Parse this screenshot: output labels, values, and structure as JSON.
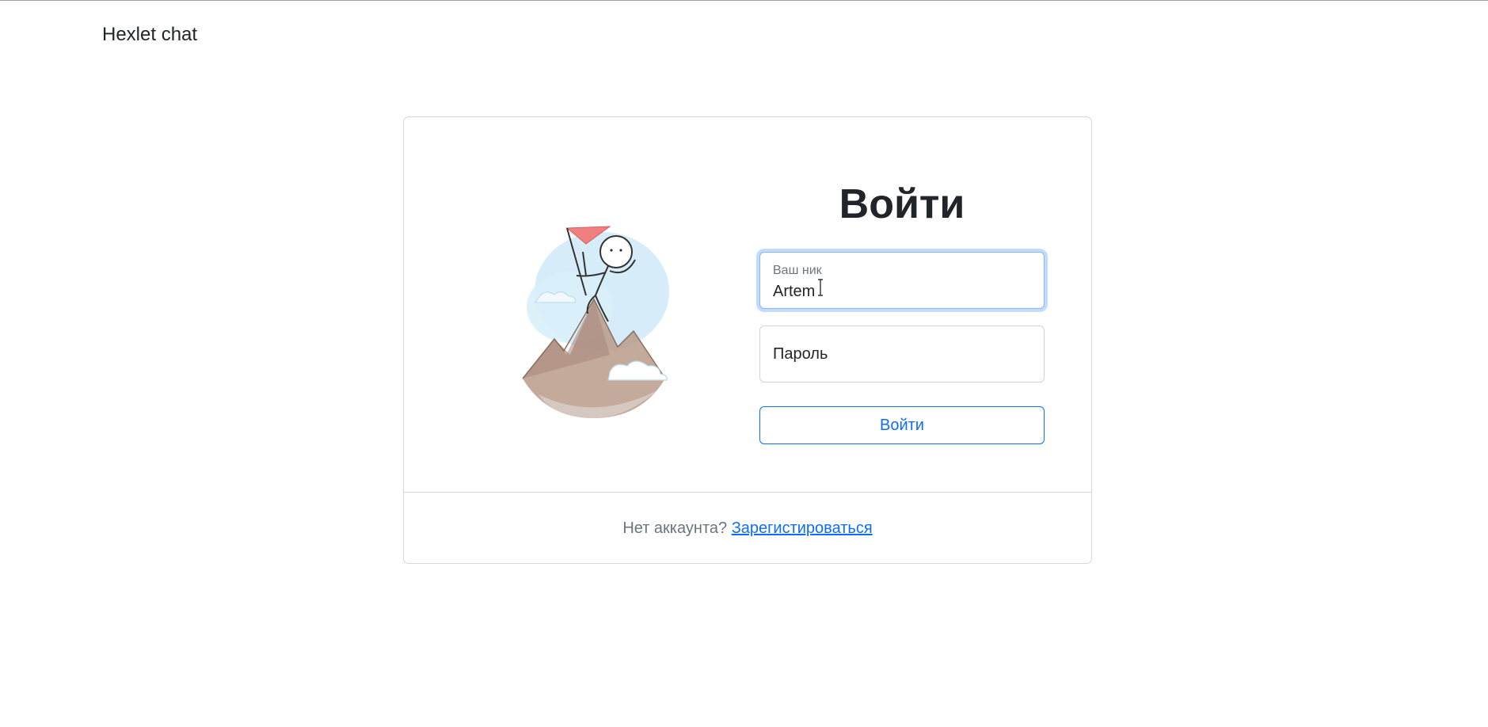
{
  "navbar": {
    "brand": "Hexlet chat"
  },
  "login": {
    "title": "Войти",
    "username": {
      "label": "Ваш ник",
      "value": "Artem"
    },
    "password": {
      "placeholder": "Пароль",
      "value": ""
    },
    "submit_label": "Войти"
  },
  "footer": {
    "text": "Нет аккаунта?",
    "link_label": "Зарегистироваться"
  },
  "colors": {
    "accent": "#0d6efd",
    "text": "#212529",
    "muted": "#6c757d",
    "border": "#d5d8dc"
  },
  "icons": {
    "illustration": "mountain-climber-illustration",
    "cursor": "text-cursor-icon"
  }
}
